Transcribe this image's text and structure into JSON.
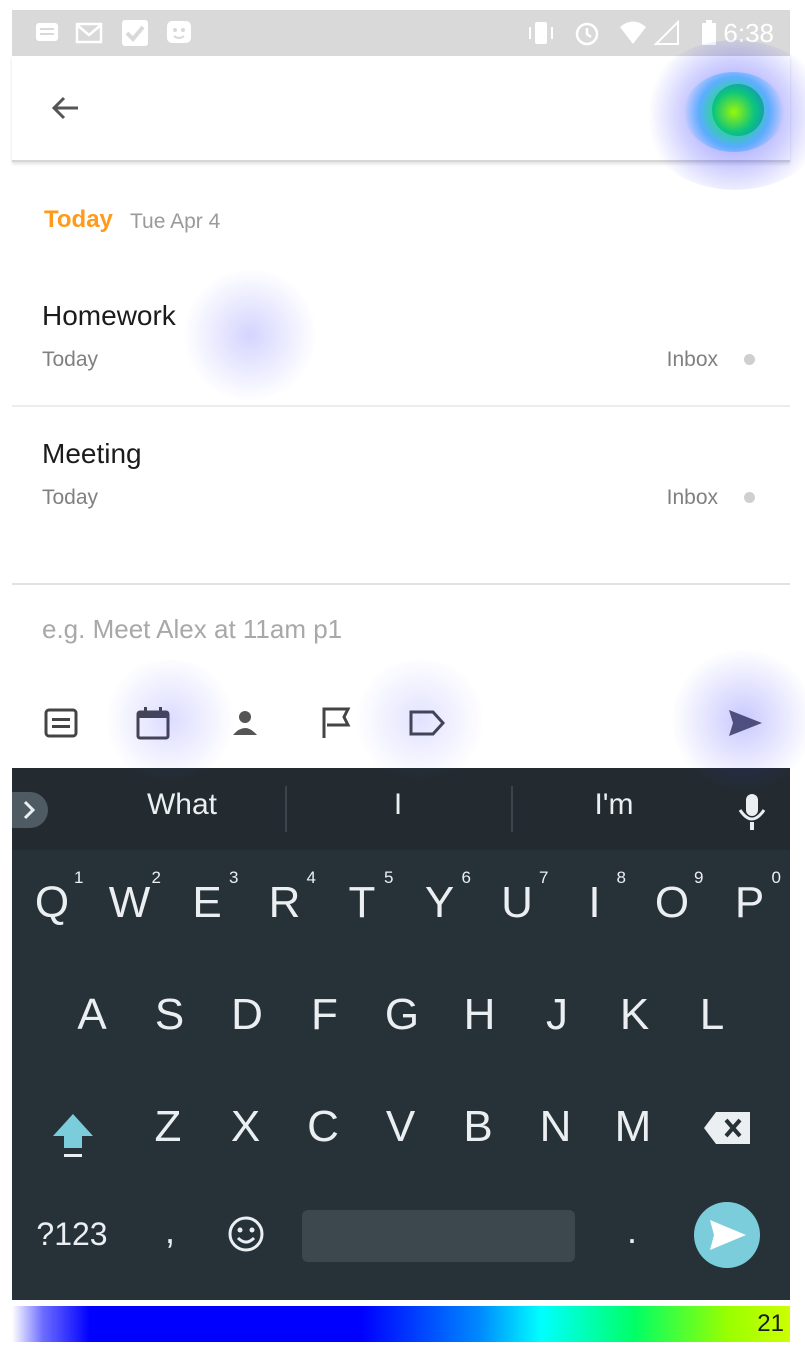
{
  "status_bar": {
    "time": "6:38"
  },
  "section": {
    "label": "Today",
    "date": "Tue Apr 4"
  },
  "tasks": [
    {
      "title": "Homework",
      "due": "Today",
      "project": "Inbox"
    },
    {
      "title": "Meeting",
      "due": "Today",
      "project": "Inbox"
    }
  ],
  "quick_add": {
    "placeholder": "e.g. Meet Alex at 11am p1"
  },
  "keyboard": {
    "suggestions": [
      "What",
      "I",
      "I'm"
    ],
    "row1": [
      "Q",
      "W",
      "E",
      "R",
      "T",
      "Y",
      "U",
      "I",
      "O",
      "P"
    ],
    "row1_hints": [
      "1",
      "2",
      "3",
      "4",
      "5",
      "6",
      "7",
      "8",
      "9",
      "0"
    ],
    "row2": [
      "A",
      "S",
      "D",
      "F",
      "G",
      "H",
      "J",
      "K",
      "L"
    ],
    "row3": [
      "Z",
      "X",
      "C",
      "V",
      "B",
      "N",
      "M"
    ],
    "symbols_key": "?123",
    "comma_key": ",",
    "period_key": "."
  },
  "heatmap_legend": {
    "max_value": "21"
  },
  "colors": {
    "accent": "#ff9a1a",
    "keyboard_bg": "#263238",
    "enter_key": "#7ccddc"
  }
}
